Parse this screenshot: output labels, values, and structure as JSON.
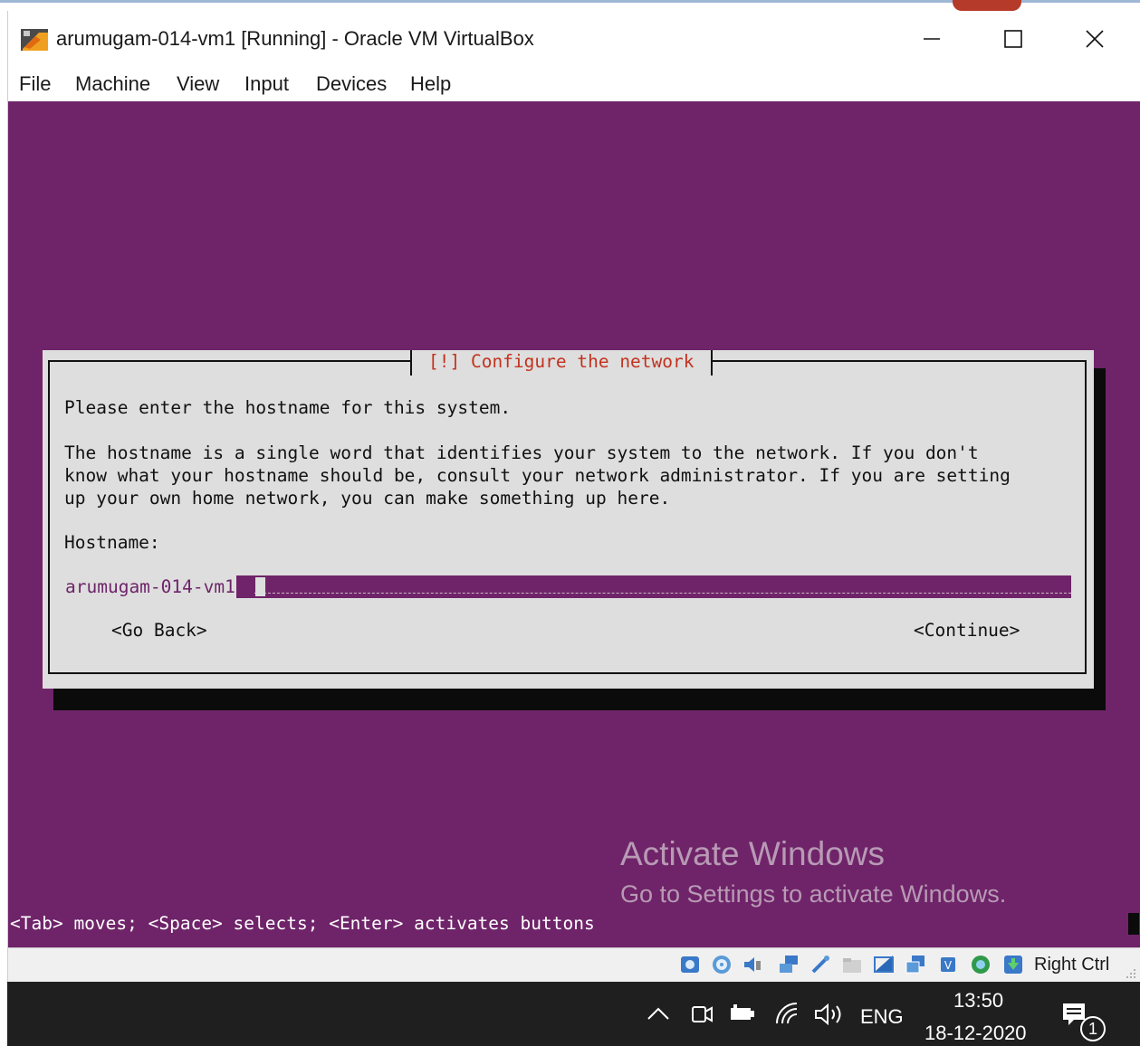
{
  "window": {
    "title": "arumugam-014-vm1 [Running] - Oracle VM VirtualBox",
    "minimize_icon": "minimize-icon",
    "maximize_icon": "maximize-icon",
    "close_icon": "close-icon"
  },
  "menu": {
    "items": [
      "File",
      "Machine",
      "View",
      "Input",
      "Devices",
      "Help"
    ]
  },
  "dialog": {
    "title": "[!] Configure the network",
    "intro": "Please enter the hostname for this system.",
    "description": "The hostname is a single word that identifies your system to the network. If you don't\nknow what your hostname should be, consult your network administrator. If you are setting\nup your own home network, you can make something up here.",
    "field_label": "Hostname:",
    "hostname_value": "arumugam-014-vm1",
    "back_button": "<Go Back>",
    "continue_button": "<Continue>"
  },
  "help_line": "<Tab> moves; <Space> selects; <Enter> activates buttons",
  "watermark": {
    "title": "Activate Windows",
    "subtitle": "Go to Settings to activate Windows."
  },
  "statusbar": {
    "icons": [
      "hard-disk-icon",
      "optical-disk-icon",
      "audio-icon",
      "network-icon",
      "usb-icon",
      "shared-folders-icon",
      "display-icon",
      "video-capture-icon",
      "cpu-icon",
      "mouse-integration-icon",
      "keyboard-icon"
    ],
    "host_key": "Right Ctrl"
  },
  "taskbar": {
    "language": "ENG",
    "time": "13:50",
    "date": "18-12-2020",
    "notification_count": "1"
  },
  "colors": {
    "guest_background": "#6f2469",
    "dialog_background": "#dedede",
    "dialog_title": "#c2321e",
    "taskbar": "#1f1f1f"
  }
}
